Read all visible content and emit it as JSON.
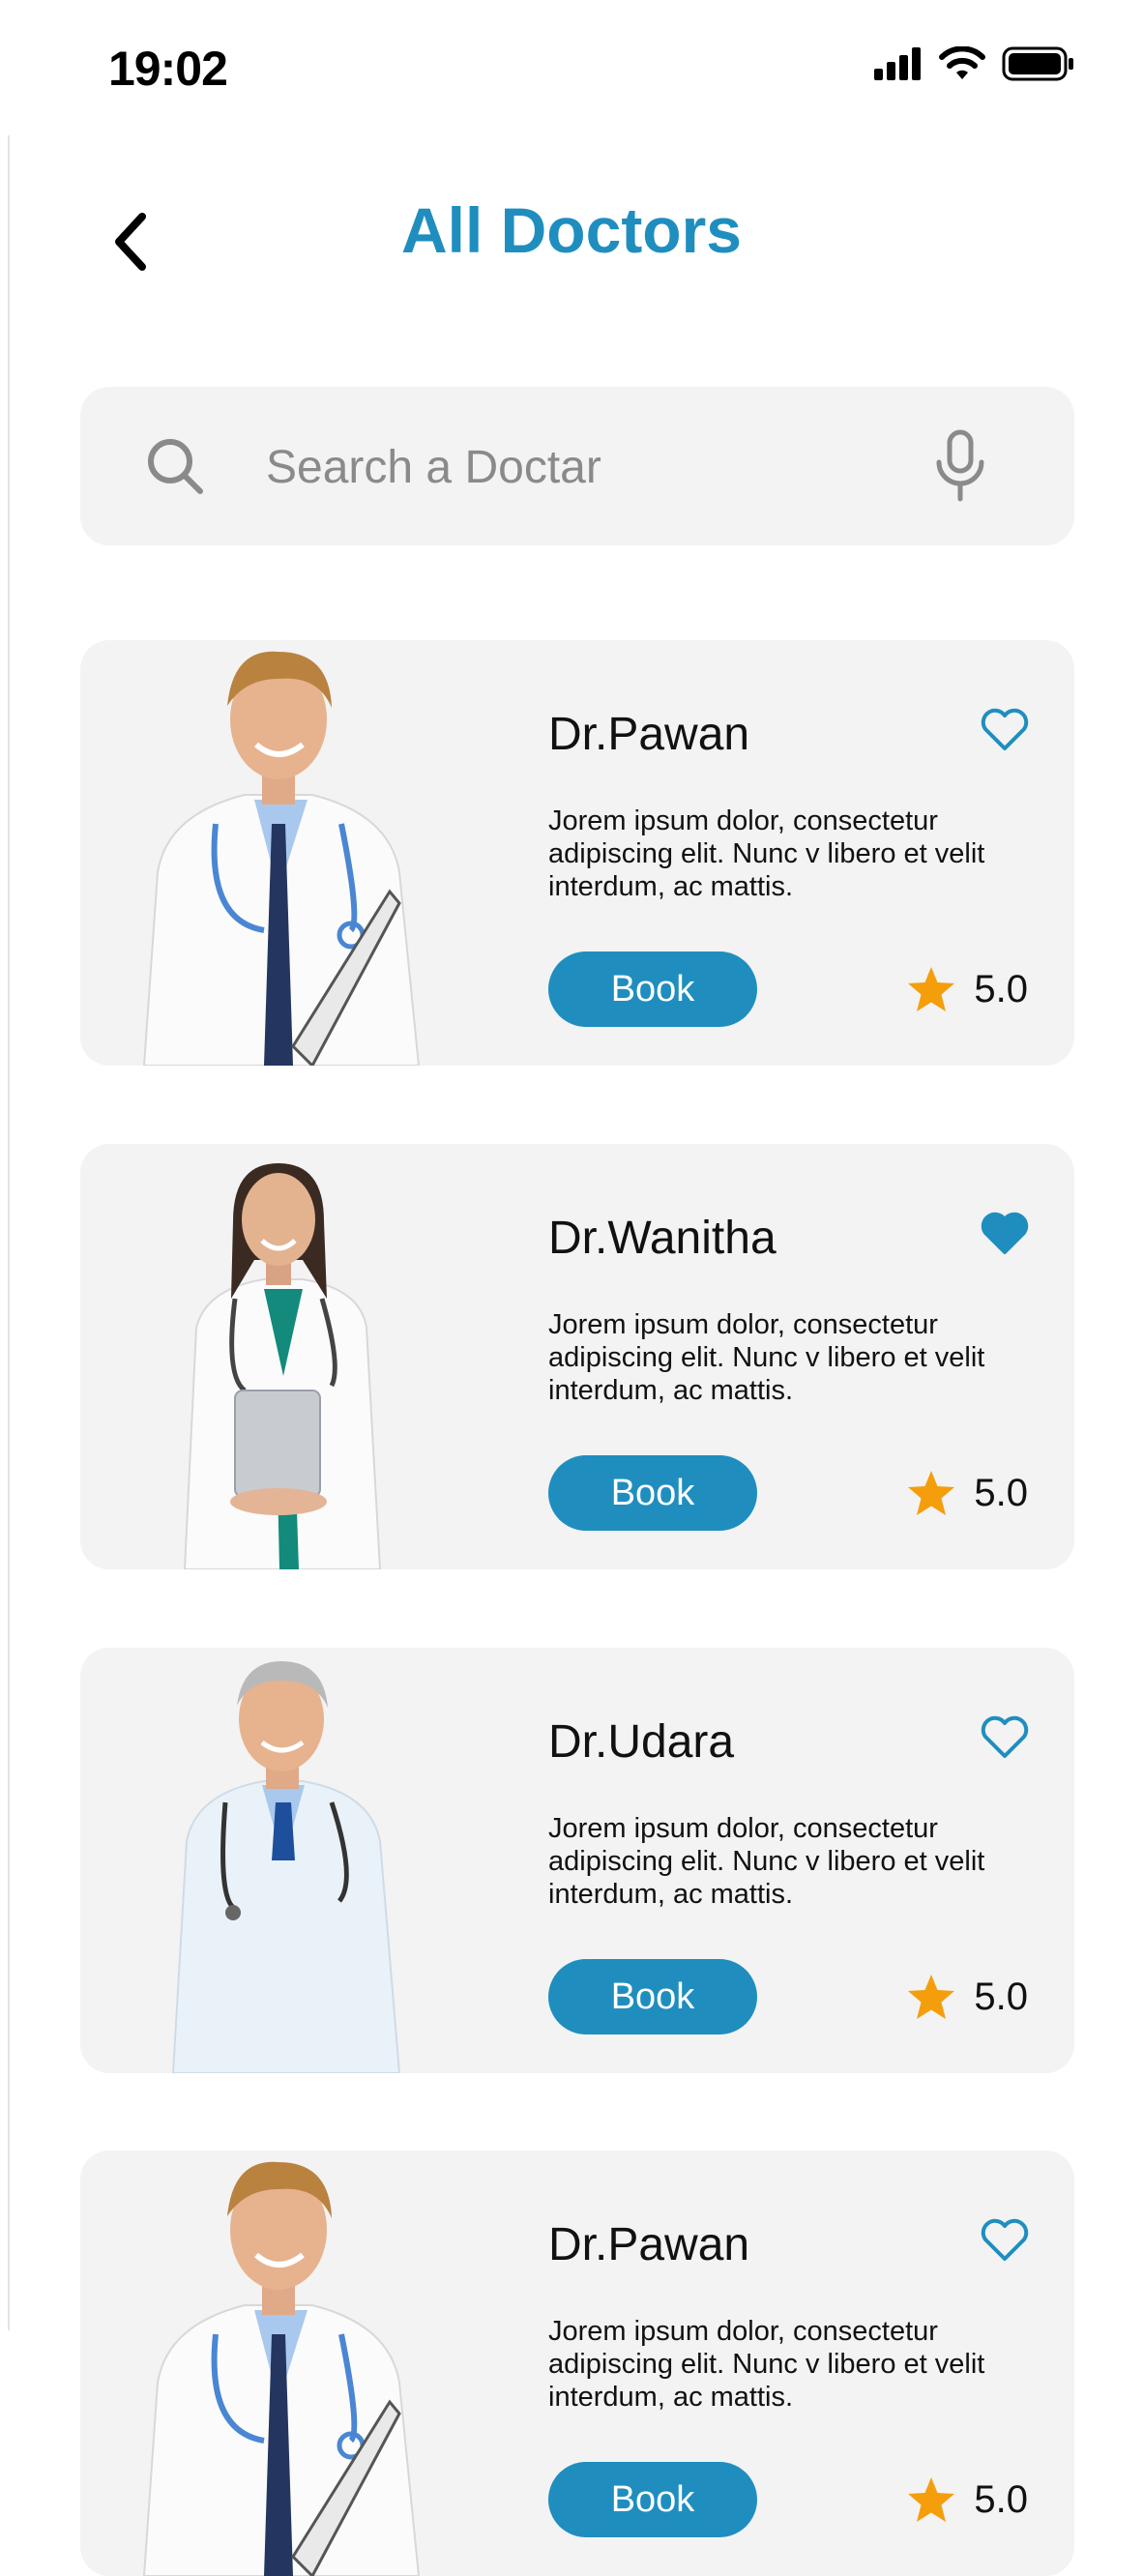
{
  "status_bar": {
    "time": "19:02"
  },
  "header": {
    "title": "All Doctors"
  },
  "search": {
    "placeholder": "Search a Doctar"
  },
  "colors": {
    "accent": "#1f8ebf",
    "star": "#f59e0b",
    "card_bg": "#f3f3f3"
  },
  "doctors": [
    {
      "name": "Dr.Pawan",
      "description": "Jorem ipsum dolor, consectetur adipiscing elit. Nunc v libero et velit interdum, ac  mattis.",
      "book_label": "Book",
      "rating": "5.0",
      "favorite": false
    },
    {
      "name": "Dr.Wanitha",
      "description": "Jorem ipsum dolor, consectetur adipiscing elit. Nunc v libero et velit interdum, ac  mattis.",
      "book_label": "Book",
      "rating": "5.0",
      "favorite": true
    },
    {
      "name": "Dr.Udara",
      "description": "Jorem ipsum dolor, consectetur adipiscing elit. Nunc v libero et velit interdum, ac  mattis.",
      "book_label": "Book",
      "rating": "5.0",
      "favorite": false
    },
    {
      "name": "Dr.Pawan",
      "description": "Jorem ipsum dolor, consectetur adipiscing elit. Nunc v libero et velit interdum, ac  mattis.",
      "book_label": "Book",
      "rating": "5.0",
      "favorite": false
    }
  ]
}
